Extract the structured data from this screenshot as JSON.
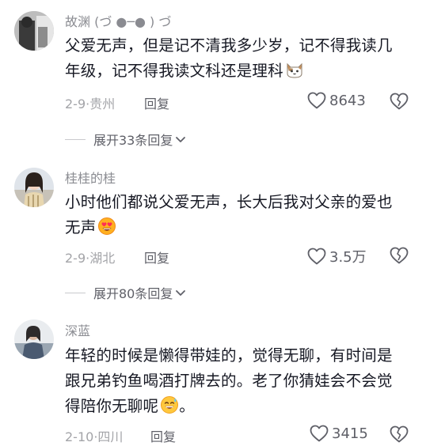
{
  "comments": [
    {
      "username": "故渊 (づ ●─● ) づ",
      "lines": [
        "父爱无声，但是记不清我多少岁，记不得我读几",
        "年级，记不得我读文科还是理科"
      ],
      "emoji": "cat-face-emoji",
      "date": "2-9",
      "location": "贵州",
      "reply_label": "回复",
      "likes": "8643",
      "expand_label": "展开33条回复",
      "icons": {
        "like": "heart-outline-icon",
        "dislike": "broken-heart-icon",
        "expand": "chevron-down-icon"
      }
    },
    {
      "username": "桂桂的桂",
      "lines": [
        "小时他们都说父爱无声，长大后我对父亲的爱也",
        "无声"
      ],
      "emoji": "heart-eyes-emoji",
      "date": "2-9",
      "location": "湖北",
      "reply_label": "回复",
      "likes": "3.5万",
      "expand_label": "展开80条回复",
      "icons": {
        "like": "heart-outline-icon",
        "dislike": "broken-heart-icon",
        "expand": "chevron-down-icon"
      }
    },
    {
      "username": "深蓝",
      "lines": [
        "年轻的时候是懒得带娃的，觉得无聊，有时间是",
        "跟兄弟钓鱼喝酒打牌去的。老了你猜娃会不会觉",
        "得陪你无聊呢"
      ],
      "tail_punct": "。",
      "emoji": "sweat-smile-emoji",
      "date": "2-10",
      "location": "四川",
      "reply_label": "回复",
      "likes": "3415",
      "icons": {
        "like": "heart-outline-icon",
        "dislike": "broken-heart-icon"
      }
    }
  ],
  "colors": {
    "username": "#8a8b91",
    "content": "#161823",
    "meta": "#a3a4a8",
    "action": "#5f6068"
  },
  "meta_separator": "·"
}
